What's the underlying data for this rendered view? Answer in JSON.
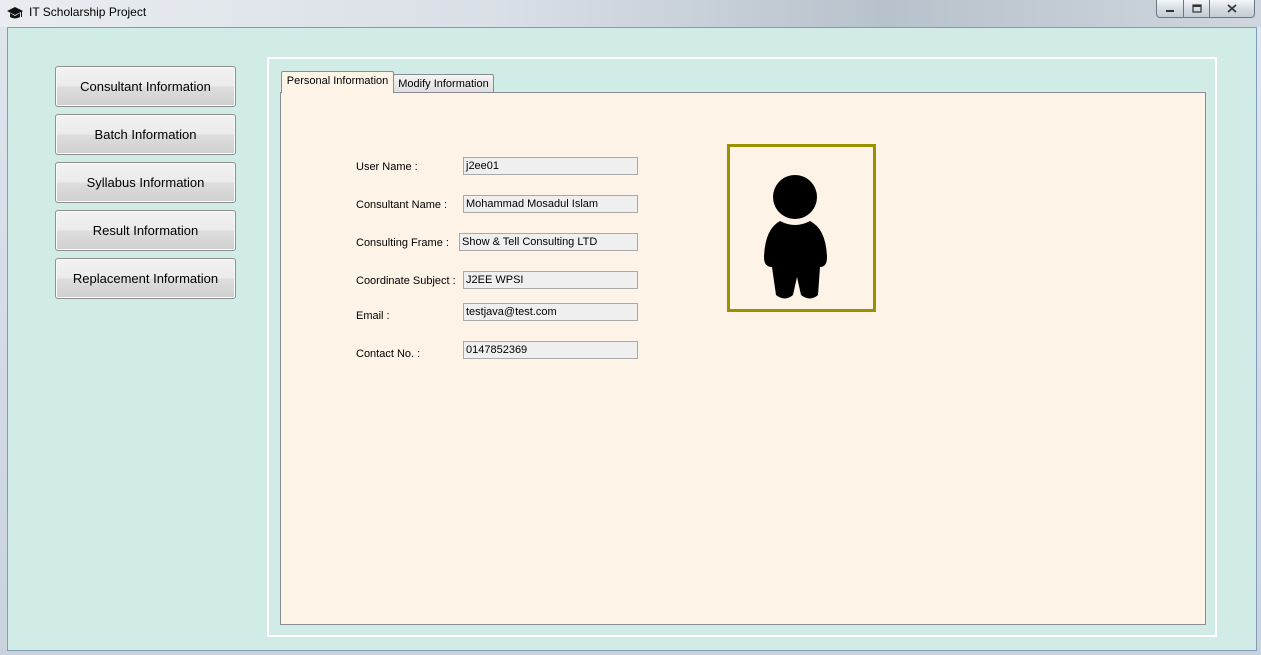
{
  "window": {
    "title": "IT Scholarship Project",
    "icon": "graduation-cap-icon"
  },
  "sidebar": {
    "items": [
      {
        "label": "Consultant Information"
      },
      {
        "label": "Batch Information"
      },
      {
        "label": "Syllabus Information"
      },
      {
        "label": "Result Information"
      },
      {
        "label": "Replacement Information"
      }
    ]
  },
  "tabs": [
    {
      "label": "Personal Information",
      "active": true
    },
    {
      "label": "Modify Information",
      "active": false
    }
  ],
  "form": {
    "user_name": {
      "label": "User Name :",
      "value": "j2ee01"
    },
    "consultant_name": {
      "label": "Consultant Name :",
      "value": "Mohammad Mosadul Islam"
    },
    "consulting_frame": {
      "label": "Consulting Frame :",
      "value": "Show & Tell Consulting LTD"
    },
    "coordinate_subject": {
      "label": "Coordinate Subject :",
      "value": "J2EE WPSI"
    },
    "email": {
      "label": "Email :",
      "value": "testjava@test.com"
    },
    "contact_no": {
      "label": "Contact No. :",
      "value": "0147852369"
    }
  },
  "photo": {
    "icon": "person-silhouette-icon",
    "border_color": "#9b9100"
  },
  "colors": {
    "client_bg": "#d1ece6",
    "content_bg": "#fdf4e7"
  }
}
